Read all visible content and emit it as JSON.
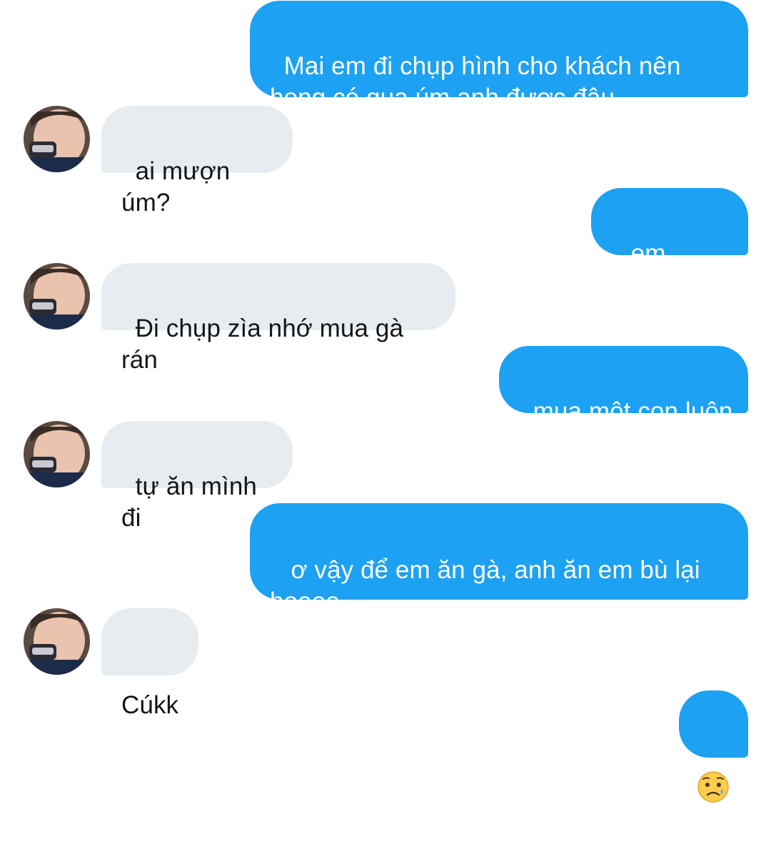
{
  "messages": [
    {
      "side": "sent",
      "text": "Mai em đi chụp hình cho khách nên\nhong có qua úm anh được đâu"
    },
    {
      "side": "received",
      "text": "ai mượn úm?"
    },
    {
      "side": "sent",
      "text": "em mượn"
    },
    {
      "side": "received",
      "text": "Đi chụp zìa nhớ mua gà rán"
    },
    {
      "side": "sent",
      "text": "mua một con luôn"
    },
    {
      "side": "received",
      "text": "tự ăn mình đi"
    },
    {
      "side": "sent",
      "text": " ơ vậy để em ăn gà, anh ăn em bù lại\nhoooo"
    },
    {
      "side": "received",
      "text": "Cúkk"
    },
    {
      "side": "sent",
      "emoji": "sad-relieved-face"
    }
  ],
  "colors": {
    "sent_bubble": "#1da1f2",
    "received_bubble": "#e6ecf0",
    "sent_text": "#ffffff",
    "received_text": "#14171a"
  }
}
